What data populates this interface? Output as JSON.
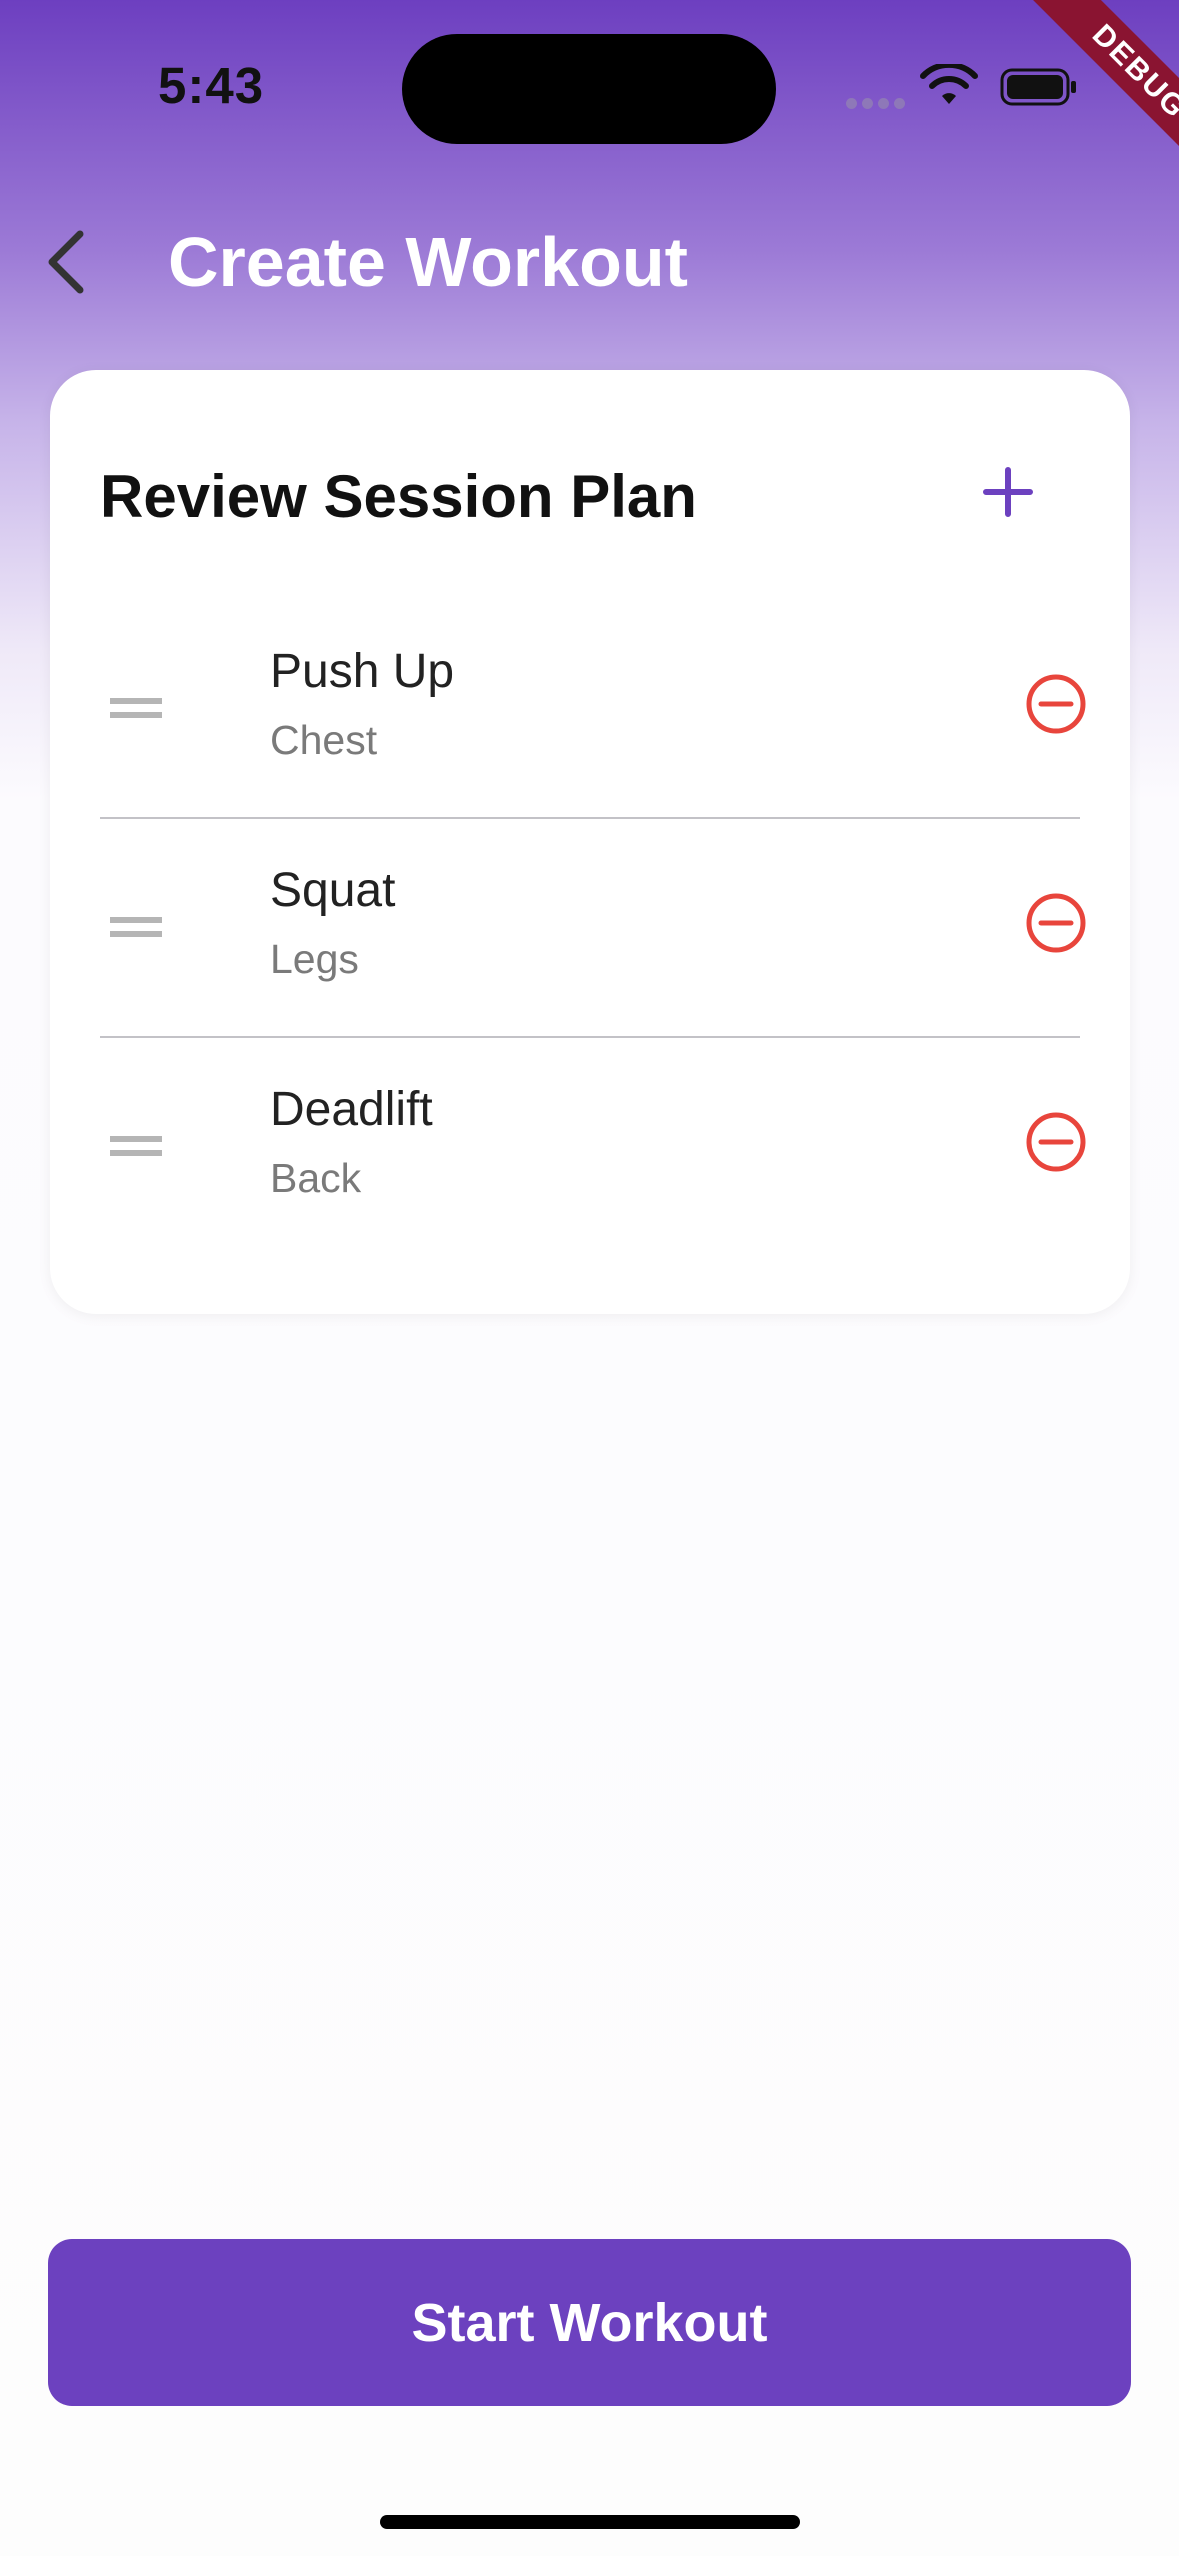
{
  "status_bar": {
    "time": "5:43",
    "icons": [
      "signal-dots-icon",
      "wifi-icon",
      "battery-icon"
    ]
  },
  "debug_banner": "DEBUG",
  "header": {
    "title": "Create Workout",
    "back_icon": "chevron-left-icon"
  },
  "card": {
    "title": "Review Session Plan",
    "add_icon": "plus-icon",
    "items": [
      {
        "name": "Push Up",
        "category": "Chest"
      },
      {
        "name": "Squat",
        "category": "Legs"
      },
      {
        "name": "Deadlift",
        "category": "Back"
      }
    ]
  },
  "footer": {
    "start_label": "Start Workout"
  },
  "colors": {
    "accent": "#6c41bf",
    "remove": "#e8453c",
    "debug": "#8a1431"
  }
}
